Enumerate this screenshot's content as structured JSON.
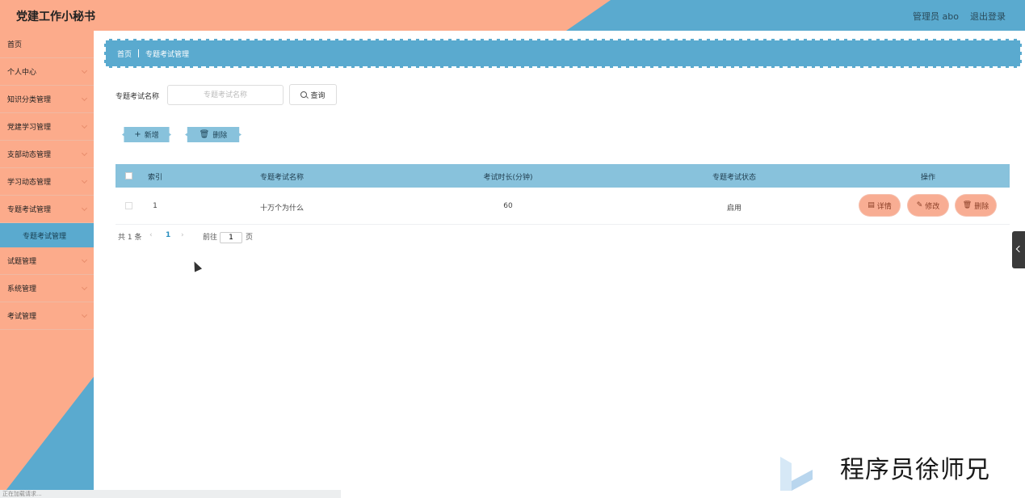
{
  "header": {
    "title": "党建工作小秘书",
    "user": "管理员 abo",
    "logout": "退出登录"
  },
  "sidebar": {
    "items": [
      {
        "label": "首页",
        "has_children": false
      },
      {
        "label": "个人中心",
        "has_children": true
      },
      {
        "label": "知识分类管理",
        "has_children": true
      },
      {
        "label": "党建学习管理",
        "has_children": true
      },
      {
        "label": "支部动态管理",
        "has_children": true
      },
      {
        "label": "学习动态管理",
        "has_children": true
      },
      {
        "label": "专题考试管理",
        "has_children": true,
        "expanded": true
      },
      {
        "label": "试题管理",
        "has_children": true
      },
      {
        "label": "系统管理",
        "has_children": true
      },
      {
        "label": "考试管理",
        "has_children": true
      }
    ],
    "active_sub": "专题考试管理"
  },
  "statusbar": {
    "text": "正在加载请求..."
  },
  "breadcrumb": {
    "home": "首页",
    "current": "专题考试管理"
  },
  "search": {
    "label": "专题考试名称",
    "placeholder": "专题考试名称",
    "value": "",
    "button": "查询"
  },
  "toolbar": {
    "add": "新增",
    "delete": "删除"
  },
  "table": {
    "columns": [
      "索引",
      "专题考试名称",
      "考试时长(分钟)",
      "专题考试状态",
      "操作"
    ],
    "rows": [
      {
        "index": "1",
        "name": "十万个为什么",
        "duration": "60",
        "status": "启用"
      }
    ],
    "actions": {
      "detail": "详情",
      "edit": "修改",
      "delete": "删除"
    }
  },
  "pagination": {
    "total": "共 1 条",
    "current_page": "1",
    "goto_label": "前往",
    "goto_value": "1",
    "page_suffix": "页"
  },
  "watermark": {
    "text": "程序员徐师兄"
  },
  "colors": {
    "peach": "#fcab8b",
    "blue": "#5aaacf",
    "table_header": "#88c2dc",
    "action_button": "#f8ad93"
  },
  "icons": [
    "search-icon",
    "plus-icon",
    "trash-icon",
    "document-icon",
    "edit-icon",
    "chevron-down-icon",
    "chevron-left-icon",
    "chevron-right-icon"
  ]
}
